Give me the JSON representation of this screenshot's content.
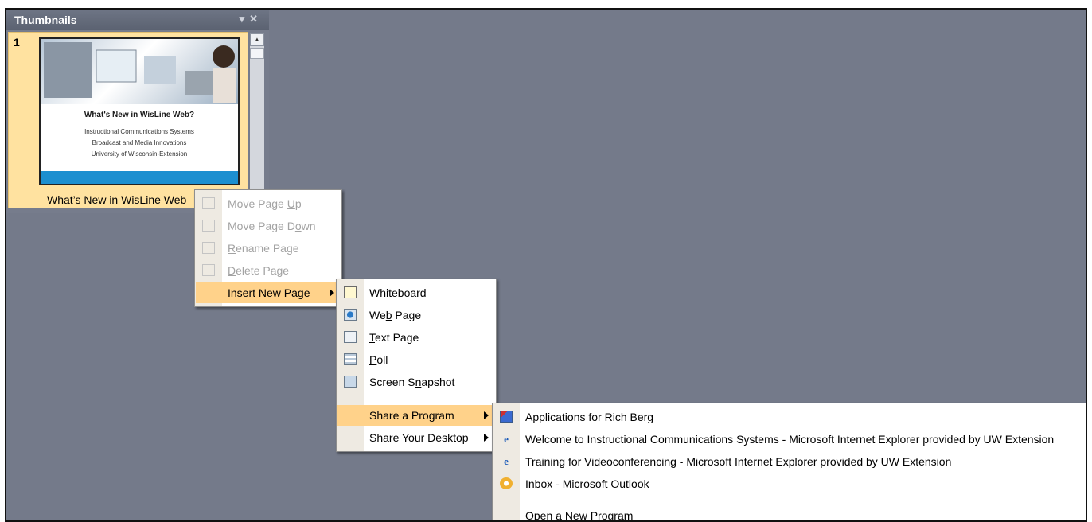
{
  "thumbnails_panel": {
    "title": "Thumbnails",
    "slide": {
      "number": "1",
      "caption": "What’s New in WisLine Web",
      "thumb_title": "What's New in WisLine Web?",
      "thumb_lines": [
        "Instructional Communications Systems",
        "Broadcast and Media Innovations",
        "University of Wisconsin-Extension"
      ]
    }
  },
  "context_menu": {
    "items": [
      {
        "pre": "Move Page ",
        "key": "U",
        "post": "p",
        "disabled": true
      },
      {
        "pre": "Move Page D",
        "key": "o",
        "post": "wn",
        "disabled": true
      },
      {
        "pre": "",
        "key": "R",
        "post": "ename Page",
        "disabled": true
      },
      {
        "pre": "",
        "key": "D",
        "post": "elete Page",
        "disabled": true
      },
      {
        "pre": "",
        "key": "I",
        "post": "nsert New Page",
        "disabled": false,
        "highlighted": true
      }
    ]
  },
  "insert_submenu": {
    "items": [
      {
        "pre": "",
        "key": "W",
        "post": "hiteboard",
        "icon": "whiteboard-icon"
      },
      {
        "pre": "We",
        "key": "b",
        "post": " Page",
        "icon": "web-page-icon"
      },
      {
        "pre": "",
        "key": "T",
        "post": "ext Page",
        "icon": "text-page-icon"
      },
      {
        "pre": "",
        "key": "P",
        "post": "oll",
        "icon": "poll-icon"
      },
      {
        "pre": "Screen S",
        "key": "n",
        "post": "apshot",
        "icon": "screen-snapshot-icon"
      }
    ],
    "share_program": "Share a Program",
    "share_desktop": "Share Your Desktop"
  },
  "share_submenu": {
    "items": [
      {
        "label": "Applications for Rich Berg",
        "icon": "applications-icon"
      },
      {
        "label": "Welcome to Instructional Communications Systems - Microsoft Internet Explorer provided by UW Extension",
        "icon": "internet-explorer-icon"
      },
      {
        "label": "Training for Videoconferencing - Microsoft Internet Explorer provided by UW Extension",
        "icon": "internet-explorer-icon"
      },
      {
        "label": "Inbox - Microsoft Outlook",
        "icon": "outlook-icon"
      }
    ],
    "open_new": "Open a New Program"
  },
  "colors": {
    "background": "#747a8a",
    "highlight": "#ffd28a",
    "selected_slide": "#ffe2a0"
  }
}
